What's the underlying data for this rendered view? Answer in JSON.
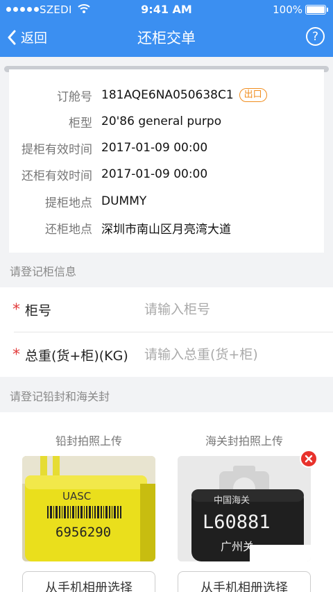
{
  "status_bar": {
    "carrier": "SZEDI",
    "time": "9:41 AM",
    "battery": "100%"
  },
  "nav": {
    "back_label": "返回",
    "title": "还柜交单"
  },
  "order": {
    "rows": [
      {
        "label": "订舱号",
        "value": "181AQE6NA050638C1",
        "badge": "出口"
      },
      {
        "label": "柜型",
        "value": "20'86 general purpo"
      },
      {
        "label": "提柜有效时间",
        "value": "2017-01-09 00:00"
      },
      {
        "label": "还柜有效时间",
        "value": "2017-01-09 00:00"
      },
      {
        "label": "提柜地点",
        "value": "DUMMY"
      },
      {
        "label": "还柜地点",
        "value": "深圳市南山区月亮湾大道"
      }
    ]
  },
  "container_section": {
    "title": "请登记柜信息",
    "fields": [
      {
        "label": "柜号",
        "placeholder": "请输入柜号",
        "value": ""
      },
      {
        "label": "总重(货+柜)(KG)",
        "placeholder": "请输入总重(货+柜)",
        "value": ""
      }
    ]
  },
  "seal_section": {
    "title": "请登记铅封和海关封",
    "lead_seal": {
      "title": "铅封拍照上传",
      "button": "从手机相册选择",
      "brand": "UASC",
      "number": "6956290"
    },
    "customs_seal": {
      "title": "海关封拍照上传",
      "button": "从手机相册选择",
      "top_text": "中国海关",
      "number": "L60881",
      "bottom_text": "广州关"
    }
  },
  "colors": {
    "header": "#3b8ff1",
    "badge": "#f08c1c",
    "required": "#e23b3b",
    "remove": "#e8322c"
  }
}
